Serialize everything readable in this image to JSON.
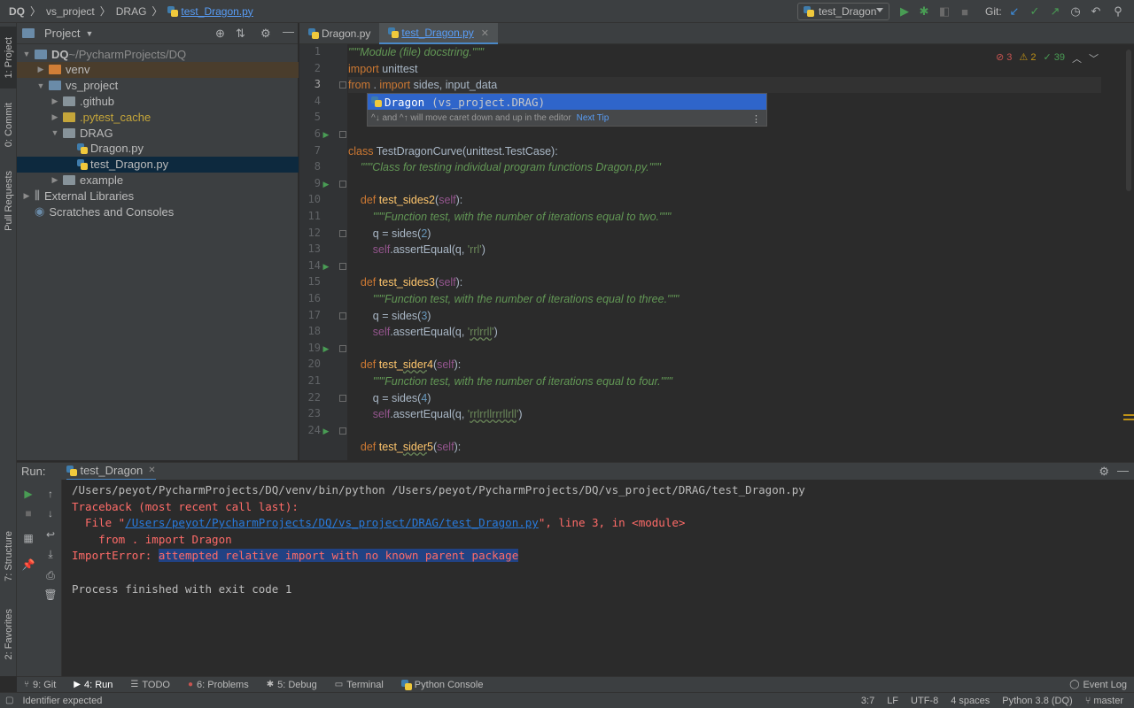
{
  "breadcrumb": [
    "DQ",
    "vs_project",
    "DRAG",
    "test_Dragon.py"
  ],
  "toolbar": {
    "run_config": "test_Dragon",
    "git_label": "Git:"
  },
  "left_strip": {
    "project": "1: Project",
    "commit": "0: Commit",
    "pull_requests": "Pull Requests",
    "structure": "7: Structure",
    "favorites": "2: Favorites"
  },
  "project_panel": {
    "title": "Project",
    "tree": [
      {
        "label": "DQ",
        "extra": "~/PycharmProjects/DQ",
        "indent": 0,
        "kind": "folder",
        "expanded": true
      },
      {
        "label": "venv",
        "indent": 1,
        "kind": "folder-orange",
        "expanded": false
      },
      {
        "label": "vs_project",
        "indent": 1,
        "kind": "folder",
        "expanded": true
      },
      {
        "label": ".github",
        "indent": 2,
        "kind": "folder",
        "expanded": false
      },
      {
        "label": ".pytest_cache",
        "indent": 2,
        "kind": "folder-yellow",
        "expanded": false
      },
      {
        "label": "DRAG",
        "indent": 2,
        "kind": "folder",
        "expanded": true
      },
      {
        "label": "Dragon.py",
        "indent": 3,
        "kind": "py"
      },
      {
        "label": "test_Dragon.py",
        "indent": 3,
        "kind": "py",
        "selected": true
      },
      {
        "label": "example",
        "indent": 2,
        "kind": "folder",
        "expanded": false
      },
      {
        "label": "External Libraries",
        "indent": 0,
        "kind": "lib",
        "expanded": false
      },
      {
        "label": "Scratches and Consoles",
        "indent": 0,
        "kind": "scratch"
      }
    ]
  },
  "editor": {
    "tabs": [
      {
        "label": "Dragon.py",
        "active": false
      },
      {
        "label": "test_Dragon.py",
        "active": true
      }
    ],
    "inspections": {
      "errors": "3",
      "warnings": "2",
      "ok": "39"
    },
    "autocomplete": {
      "item": "Dragon",
      "location": "(vs_project.DRAG)",
      "tip": "^↓ and ^↑ will move caret down and up in the editor",
      "next_tip": "Next Tip"
    },
    "line_numbers": [
      "1",
      "2",
      "3",
      "4",
      "5",
      "6",
      "7",
      "8",
      "9",
      "10",
      "11",
      "12",
      "13",
      "14",
      "15",
      "16",
      "17",
      "18",
      "19",
      "20",
      "21",
      "22",
      "23",
      "24"
    ]
  },
  "run_panel": {
    "label": "Run:",
    "tab": "test_Dragon",
    "output": [
      {
        "text": "/Users/peyot/PycharmProjects/DQ/venv/bin/python /Users/peyot/PycharmProjects/DQ/vs_project/DRAG/test_Dragon.py",
        "kind": "normal"
      },
      {
        "text": "Traceback (most recent call last):",
        "kind": "err"
      },
      {
        "pre": "  File \"",
        "link": "/Users/peyot/PycharmProjects/DQ/vs_project/DRAG/test_Dragon.py",
        "post": "\", line 3, in <module>",
        "kind": "file"
      },
      {
        "text": "    from . import Dragon",
        "kind": "err"
      },
      {
        "pre": "ImportError: ",
        "highlight": "attempted relative import with no known parent package",
        "kind": "importerr"
      },
      {
        "text": "",
        "kind": "normal"
      },
      {
        "text": "Process finished with exit code 1",
        "kind": "normal"
      }
    ]
  },
  "bottom_tabs": [
    {
      "label": "9: Git",
      "icon": "git"
    },
    {
      "label": "4: Run",
      "icon": "run",
      "active": true
    },
    {
      "label": "TODO",
      "icon": "todo"
    },
    {
      "label": "6: Problems",
      "icon": "problems"
    },
    {
      "label": "5: Debug",
      "icon": "debug"
    },
    {
      "label": "Terminal",
      "icon": "terminal"
    },
    {
      "label": "Python Console",
      "icon": "python"
    }
  ],
  "event_log": "Event Log",
  "status_bar": {
    "message": "Identifier expected",
    "position": "3:7",
    "line_sep": "LF",
    "encoding": "UTF-8",
    "indent": "4 spaces",
    "interpreter": "Python 3.8 (DQ)",
    "branch": "master"
  },
  "colors": {
    "accent": "#4a88c7",
    "error": "#ff6b68",
    "keyword": "#cc7832",
    "docstring": "#629755"
  }
}
